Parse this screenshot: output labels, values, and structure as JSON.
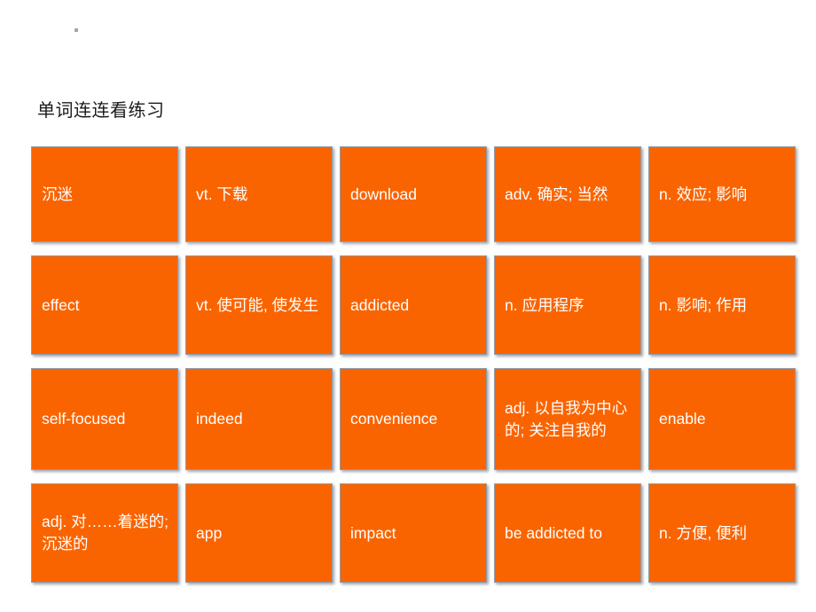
{
  "slide": {
    "title": "单词连连看练习",
    "background_color": "#ffffff",
    "card_color": "#FA6400",
    "card_text_color": "#ffffff",
    "card_border_color": "#8f9aa8",
    "title_color": "#1a1a1a"
  },
  "cards": [
    {
      "label": "沉迷"
    },
    {
      "label": "vt. 下载"
    },
    {
      "label": "download"
    },
    {
      "label": "adv. 确实; 当然"
    },
    {
      "label": "n. 效应; 影响"
    },
    {
      "label": "effect"
    },
    {
      "label": "vt. 使可能, 使发生"
    },
    {
      "label": "addicted"
    },
    {
      "label": "n. 应用程序"
    },
    {
      "label": "n. 影响; 作用"
    },
    {
      "label": "self-focused"
    },
    {
      "label": "indeed"
    },
    {
      "label": "convenience"
    },
    {
      "label": "adj. 以自我为中心的; 关注自我的"
    },
    {
      "label": "enable"
    },
    {
      "label": "adj. 对……着迷的; 沉迷的"
    },
    {
      "label": "app"
    },
    {
      "label": "impact"
    },
    {
      "label": "be addicted to"
    },
    {
      "label": "n. 方便, 便利"
    }
  ]
}
